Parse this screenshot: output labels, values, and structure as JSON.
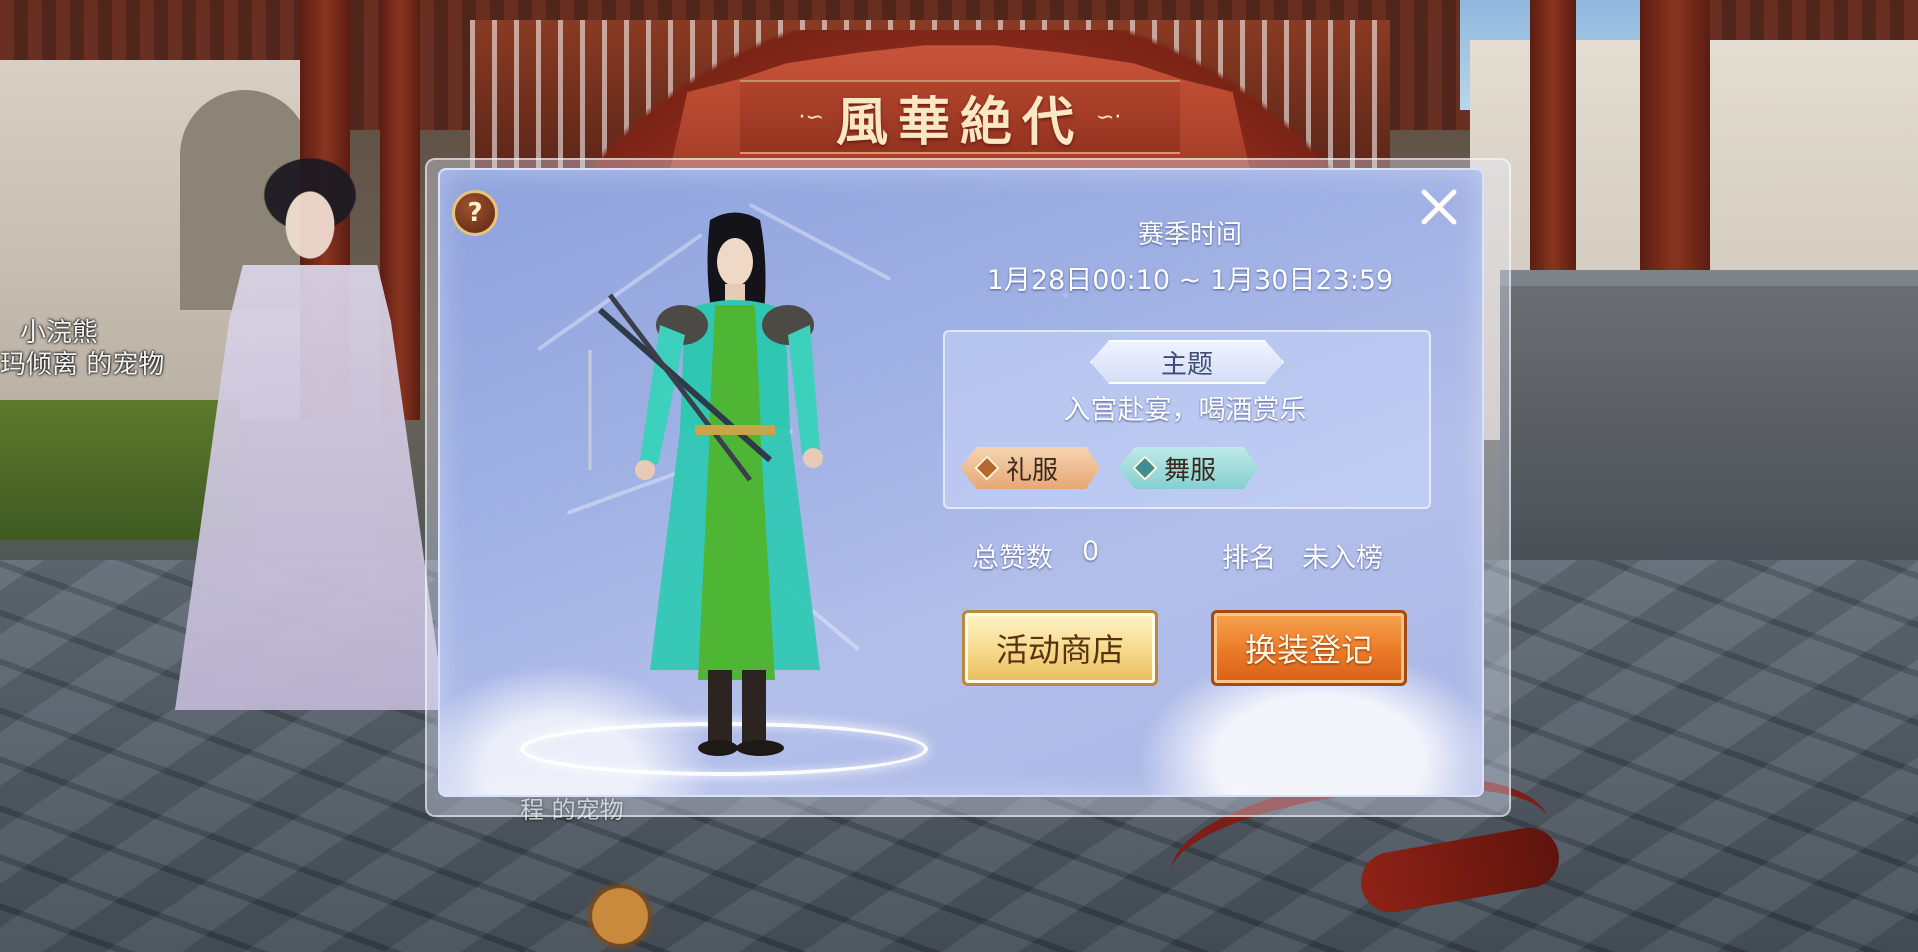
{
  "world": {
    "npc_name": "小浣熊",
    "pet_owner_label": "玛倾离 的宠物",
    "pet_label_below": "程   的宠物"
  },
  "banner": {
    "title": "風華絶代"
  },
  "dialog": {
    "help_icon": "question-icon",
    "help_glyph": "?",
    "close_icon": "close-icon",
    "season": {
      "title": "赛季时间",
      "range": "1月28日00:10 ~ 1月30日23:59"
    },
    "theme": {
      "tag_label": "主题",
      "description": "入宫赴宴，喝酒赏乐",
      "outfits": [
        {
          "label": "礼服",
          "color": "#e6a777"
        },
        {
          "label": "舞服",
          "color": "#86cfd0"
        }
      ]
    },
    "stats": {
      "likes_label": "总赞数",
      "likes_value": "0",
      "rank_label": "排名",
      "rank_value": "未入榜"
    },
    "buttons": {
      "shop": "活动商店",
      "register": "换装登记"
    }
  },
  "colors": {
    "panel_blue": "#9fb0e4",
    "banner_red": "#a53d27",
    "shop_gold": "#f5d98a",
    "register_orange": "#ea7a26"
  }
}
